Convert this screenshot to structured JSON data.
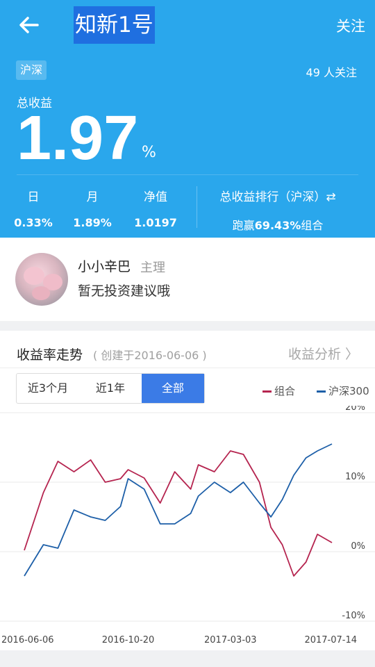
{
  "header": {
    "title": "知新1号",
    "follow_label": "关注"
  },
  "hero": {
    "market_tag": "沪深",
    "followers": "49 人关注",
    "total_label": "总收益",
    "total_value": "1.97",
    "total_unit": "%",
    "stats": [
      {
        "label": "日",
        "value": "0.33%"
      },
      {
        "label": "月",
        "value": "1.89%"
      },
      {
        "label": "净值",
        "value": "1.0197"
      }
    ],
    "rank_label": "总收益排行（沪深）⇄",
    "rank_prefix": "跑赢",
    "rank_value": "69.43%",
    "rank_suffix": "组合"
  },
  "manager": {
    "name": "小小辛巴",
    "role": "主理",
    "advice": "暂无投资建议哦"
  },
  "chart_section": {
    "title": "收益率走势",
    "subtitle": "( 创建于2016-06-06 )",
    "analysis_link": "收益分析 〉",
    "ranges": [
      "近3个月",
      "近1年",
      "全部"
    ],
    "active_range": "全部"
  },
  "colors": {
    "portfolio": "#b5244f",
    "index": "#1d5fa8",
    "brand": "#2aa7ec",
    "active": "#3b7be6"
  },
  "chart_data": {
    "type": "line",
    "x": [
      "2016-06-06",
      "2016-07-01",
      "2016-07-20",
      "2016-08-10",
      "2016-09-01",
      "2016-09-20",
      "2016-10-10",
      "2016-10-20",
      "2016-11-10",
      "2016-12-01",
      "2016-12-20",
      "2017-01-10",
      "2017-01-20",
      "2017-02-10",
      "2017-03-03",
      "2017-03-20",
      "2017-04-10",
      "2017-04-25",
      "2017-05-10",
      "2017-05-25",
      "2017-06-10",
      "2017-06-25",
      "2017-07-14"
    ],
    "series": [
      {
        "name": "组合",
        "values": [
          0.2,
          8.5,
          13.0,
          11.5,
          13.2,
          10.0,
          10.5,
          11.8,
          10.6,
          7.0,
          11.5,
          9.0,
          12.5,
          11.5,
          14.5,
          14.0,
          10.0,
          3.5,
          1.0,
          -3.5,
          -1.5,
          2.5,
          1.3
        ]
      },
      {
        "name": "沪深300",
        "values": [
          -3.5,
          1.0,
          0.5,
          6.0,
          5.0,
          4.5,
          6.5,
          10.5,
          9.0,
          4.0,
          4.0,
          5.5,
          8.0,
          10.0,
          8.5,
          10.0,
          7.0,
          5.0,
          7.5,
          11.0,
          13.5,
          14.5,
          15.5
        ]
      }
    ],
    "ylim": [
      -10,
      20
    ],
    "yticks": [
      "20%",
      "10%",
      "0%",
      "-10%"
    ],
    "xticks": [
      "2016-06-06",
      "2016-10-20",
      "2017-03-03",
      "2017-07-14"
    ],
    "legend": [
      "组合",
      "沪深300"
    ],
    "legend_position": "top-right",
    "grid": true
  }
}
